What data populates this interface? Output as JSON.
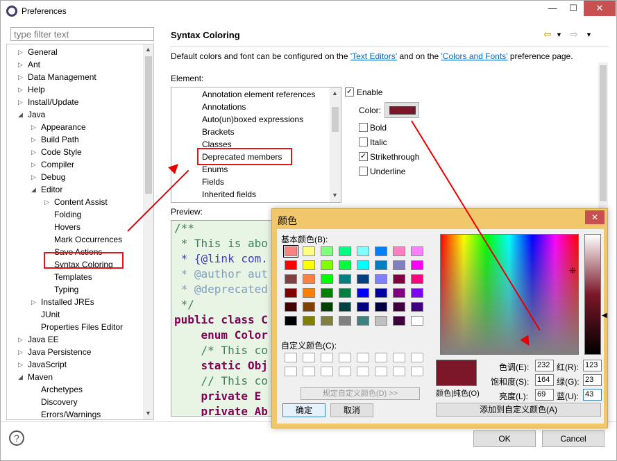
{
  "window": {
    "title": "Preferences"
  },
  "filter": {
    "placeholder": "type filter text"
  },
  "tree": [
    {
      "label": "General",
      "depth": 0,
      "exp": "c"
    },
    {
      "label": "Ant",
      "depth": 0,
      "exp": "c"
    },
    {
      "label": "Data Management",
      "depth": 0,
      "exp": "c"
    },
    {
      "label": "Help",
      "depth": 0,
      "exp": "c"
    },
    {
      "label": "Install/Update",
      "depth": 0,
      "exp": "c"
    },
    {
      "label": "Java",
      "depth": 0,
      "exp": "e"
    },
    {
      "label": "Appearance",
      "depth": 1,
      "exp": "c"
    },
    {
      "label": "Build Path",
      "depth": 1,
      "exp": "c"
    },
    {
      "label": "Code Style",
      "depth": 1,
      "exp": "c"
    },
    {
      "label": "Compiler",
      "depth": 1,
      "exp": "c"
    },
    {
      "label": "Debug",
      "depth": 1,
      "exp": "c"
    },
    {
      "label": "Editor",
      "depth": 1,
      "exp": "e"
    },
    {
      "label": "Content Assist",
      "depth": 2,
      "exp": "c"
    },
    {
      "label": "Folding",
      "depth": 2,
      "exp": ""
    },
    {
      "label": "Hovers",
      "depth": 2,
      "exp": ""
    },
    {
      "label": "Mark Occurrences",
      "depth": 2,
      "exp": ""
    },
    {
      "label": "Save Actions",
      "depth": 2,
      "exp": ""
    },
    {
      "label": "Syntax Coloring",
      "depth": 2,
      "exp": ""
    },
    {
      "label": "Templates",
      "depth": 2,
      "exp": ""
    },
    {
      "label": "Typing",
      "depth": 2,
      "exp": ""
    },
    {
      "label": "Installed JREs",
      "depth": 1,
      "exp": "c"
    },
    {
      "label": "JUnit",
      "depth": 1,
      "exp": ""
    },
    {
      "label": "Properties Files Editor",
      "depth": 1,
      "exp": ""
    },
    {
      "label": "Java EE",
      "depth": 0,
      "exp": "c"
    },
    {
      "label": "Java Persistence",
      "depth": 0,
      "exp": "c"
    },
    {
      "label": "JavaScript",
      "depth": 0,
      "exp": "c"
    },
    {
      "label": "Maven",
      "depth": 0,
      "exp": "e"
    },
    {
      "label": "Archetypes",
      "depth": 1,
      "exp": ""
    },
    {
      "label": "Discovery",
      "depth": 1,
      "exp": ""
    },
    {
      "label": "Errors/Warnings",
      "depth": 1,
      "exp": ""
    }
  ],
  "page": {
    "title": "Syntax Coloring",
    "desc_before": "Default colors and font can be configured on the ",
    "link1": "'Text Editors'",
    "desc_mid": " and on the ",
    "link2": "'Colors and Fonts'",
    "desc_after": " preference page.",
    "element_label": "Element:",
    "preview_label": "Preview:"
  },
  "elements": [
    "Annotation element references",
    "Annotations",
    "Auto(un)boxed expressions",
    "Brackets",
    "Classes",
    "Deprecated members",
    "Enums",
    "Fields",
    "Inherited fields"
  ],
  "options": {
    "enable": "Enable",
    "color": "Color:",
    "bold": "Bold",
    "italic": "Italic",
    "strikethrough": "Strikethrough",
    "underline": "Underline",
    "enable_checked": true,
    "strikethrough_checked": true,
    "swatch_color": "#7b1729"
  },
  "preview_code": [
    {
      "t": "/**",
      "c": "#3f7f5f",
      "b": false
    },
    {
      "t": " * This is abo",
      "c": "#3f7f5f",
      "b": false
    },
    {
      "t": " * {@link com.",
      "c": "#3f3fbf",
      "b": false
    },
    {
      "t": " * @author aut",
      "c": "#7f9fbf",
      "b": false
    },
    {
      "t": " * @deprecated",
      "c": "#7f9fbf",
      "b": false
    },
    {
      "t": " */",
      "c": "#3f7f5f",
      "b": false
    },
    {
      "t": "public class C",
      "c": "#7f0055",
      "b": true
    },
    {
      "t": "    enum Color",
      "c": "#7f0055",
      "b": true
    },
    {
      "t": "    /* This co",
      "c": "#3f7f5f",
      "b": false
    },
    {
      "t": "    static Obj",
      "c": "#7f0055",
      "b": true
    },
    {
      "t": "    // This co",
      "c": "#3f7f5f",
      "b": false
    },
    {
      "t": "    private E",
      "c": "#7f0055",
      "b": true
    },
    {
      "t": "    private Ab",
      "c": "#7f0055",
      "b": true
    }
  ],
  "buttons": {
    "ok": "OK",
    "cancel": "Cancel"
  },
  "color_dialog": {
    "title": "颜色",
    "basic_label": "基本颜色(B):",
    "custom_label": "自定义颜色(C):",
    "define_button": "规定自定义颜色(D) >>",
    "ok": "确定",
    "cancel": "取消",
    "solid_label": "颜色|纯色(O)",
    "add_button": "添加到自定义颜色(A)",
    "hue_label": "色调(E):",
    "hue": "232",
    "sat_label": "饱和度(S):",
    "sat": "164",
    "lum_label": "亮度(L):",
    "lum": "69",
    "red_label": "红(R):",
    "red": "123",
    "green_label": "绿(G):",
    "green": "23",
    "blue_label": "蓝(U):",
    "blue": "43",
    "selected_color": "#7b1729",
    "basic_colors": [
      "#ff8080",
      "#ffff80",
      "#80ff80",
      "#00ff80",
      "#80ffff",
      "#0080ff",
      "#ff80c0",
      "#ff80ff",
      "#ff0000",
      "#ffff00",
      "#80ff00",
      "#00ff40",
      "#00ffff",
      "#0080c0",
      "#8080c0",
      "#ff00ff",
      "#804040",
      "#ff8040",
      "#00ff00",
      "#008080",
      "#004080",
      "#8080ff",
      "#800040",
      "#ff0080",
      "#800000",
      "#ff8000",
      "#008000",
      "#008040",
      "#0000ff",
      "#0000a0",
      "#800080",
      "#8000ff",
      "#400000",
      "#804000",
      "#004000",
      "#004040",
      "#000080",
      "#000040",
      "#400040",
      "#400080",
      "#000000",
      "#808000",
      "#808040",
      "#808080",
      "#408080",
      "#c0c0c0",
      "#400040",
      "#ffffff"
    ]
  }
}
